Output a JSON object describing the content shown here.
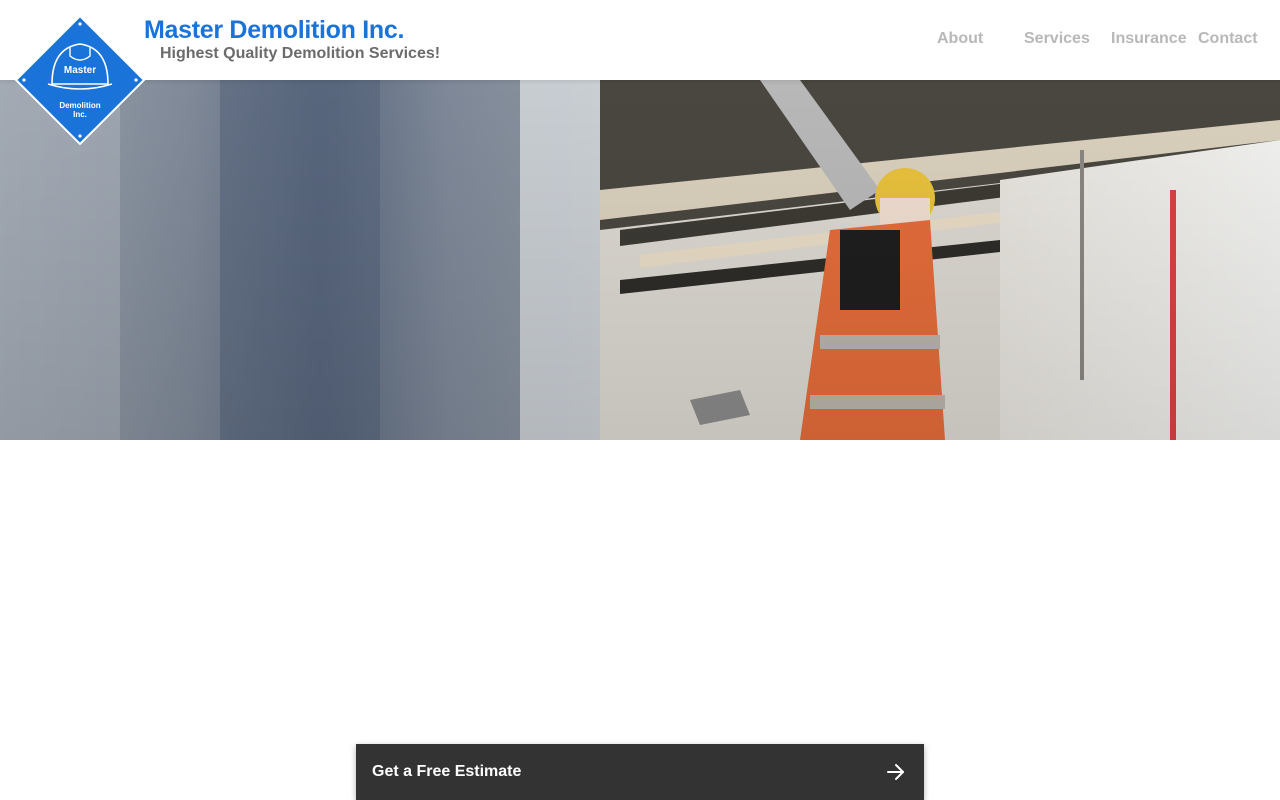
{
  "brand": {
    "name": "Master Demolition Inc.",
    "tagline": "Highest Quality Demolition Services!",
    "logo_text_top": "Master",
    "logo_text_bottom_1": "Demolition",
    "logo_text_bottom_2": "Inc.",
    "logo_color": "#1a73d9"
  },
  "nav": {
    "items": [
      {
        "label": "About"
      },
      {
        "label": "Services"
      },
      {
        "label": "Insurance"
      },
      {
        "label": "Contact"
      }
    ]
  },
  "hero": {
    "image": "demolition-worker-photo"
  },
  "cta": {
    "label": "Get a Free Estimate",
    "icon": "arrow-right-icon",
    "background": "#333333"
  }
}
